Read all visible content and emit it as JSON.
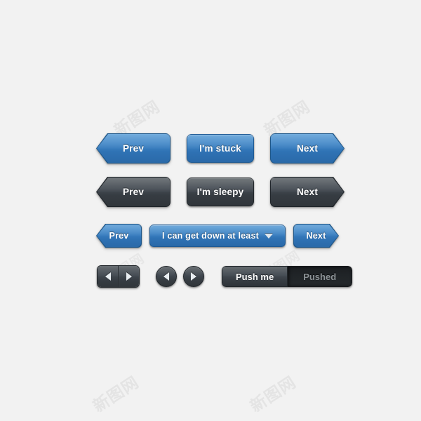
{
  "page": {
    "background_color": "#f2f2f2",
    "watermark_text": "新图网"
  },
  "theme": {
    "blue_top": "#4a93d2",
    "blue_bottom": "#2a69a8",
    "blue_border": "#1f5a93",
    "dark_top": "#4b5257",
    "dark_bottom": "#31363b",
    "dark_border": "#22272b",
    "label_color": "#ffffff",
    "disabled_label_color": "#8d9397"
  },
  "rows": {
    "row1": {
      "name": "blue-arrow-button-row",
      "style": "blue",
      "buttons": [
        {
          "label": "Prev",
          "shape": "left-arrow",
          "icon": "chevron-left-shape"
        },
        {
          "label": "I'm stuck",
          "shape": "rounded-rect",
          "icon": ""
        },
        {
          "label": "Next",
          "shape": "right-arrow",
          "icon": "chevron-right-shape"
        }
      ]
    },
    "row2": {
      "name": "dark-arrow-button-row",
      "style": "dark",
      "buttons": [
        {
          "label": "Prev",
          "shape": "left-arrow",
          "icon": "chevron-left-shape"
        },
        {
          "label": "I'm sleepy",
          "shape": "rounded-rect",
          "icon": ""
        },
        {
          "label": "Next",
          "shape": "right-arrow",
          "icon": "chevron-right-shape"
        }
      ]
    },
    "row3": {
      "name": "blue-dropdown-row",
      "style": "blue",
      "prev_label": "Prev",
      "next_label": "Next",
      "dropdown": {
        "selected": "I can get down at least",
        "caret_icon": "triangle-down-icon",
        "options": [
          "I can get down at least"
        ]
      }
    },
    "row4": {
      "name": "controls-row",
      "segmented_arrows": {
        "prev_icon": "triangle-left-icon",
        "next_icon": "triangle-right-icon"
      },
      "circle_arrows": {
        "prev_icon": "triangle-left-icon",
        "next_icon": "triangle-right-icon"
      },
      "toggle": {
        "on_label": "Push me",
        "off_label": "Pushed",
        "state": "on"
      }
    }
  }
}
